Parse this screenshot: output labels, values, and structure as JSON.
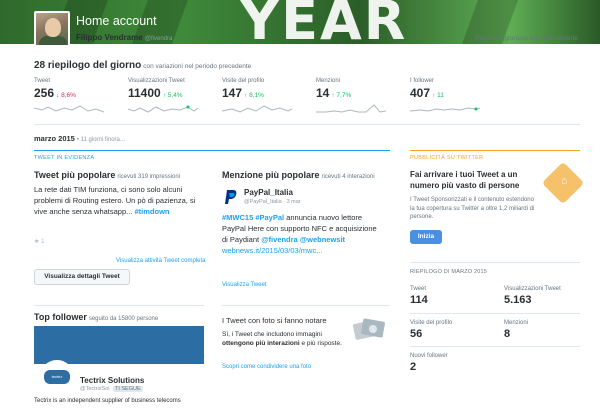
{
  "header": {
    "title": "Home account",
    "background_word": "YEAR"
  },
  "profile": {
    "name": "Filippo Vendrame",
    "handle": "@fivendra"
  },
  "updated_note": "Pagina aggiornata quotidianamente",
  "summary": {
    "title": "28 riepilogo del giorno",
    "subtitle": "con variazioni nel periodo precedente",
    "stats": [
      {
        "label": "Tweet",
        "value": "256",
        "change": "↓ 8,6%",
        "trend": "down"
      },
      {
        "label": "Visualizzazioni Tweet",
        "value": "11400",
        "change": "↑ 5,4%",
        "trend": "up"
      },
      {
        "label": "Visite del profilo",
        "value": "147",
        "change": "↑ 8,1%",
        "trend": "up"
      },
      {
        "label": "Menzioni",
        "value": "14",
        "change": "↑ 7,7%",
        "trend": "up"
      },
      {
        "label": "I follower",
        "value": "407",
        "change": "↑ 11",
        "trend": "up"
      }
    ]
  },
  "month": {
    "title": "marzo 2015",
    "subtitle": "• 11 giorni finora..."
  },
  "top_tweet": {
    "section_label": "Tweet in evidenza",
    "title": "Tweet più popolare",
    "meta": "ricevuti 319 impressioni",
    "text": "La rete dati TIM funziona, ci sono solo alcuni problemi di Routing estero. Un pò di pazienza, si vive anche senza whatsapp...",
    "hashtag": "#timdown",
    "retweet_count": "1",
    "activity_link": "Visualizza attività Tweet completa",
    "details_button": "Visualizza dettagli Tweet"
  },
  "top_mention": {
    "title": "Menzione più popolare",
    "meta": "ricevuti 4 interazioni",
    "author": "PayPal_Italia",
    "handle": "@PayPal_Italia · 3 mar",
    "text_tags": "#MWC15 #PayPal",
    "text_1": " annuncia nuovo lettore PayPal Here con supporto NFC e acquisizione di Paydiant ",
    "mention_1": "@fivendra",
    "mention_2": "@webnewsit",
    "url": "webnews.it/2015/03/03/mwc...",
    "view_link": "Visualizza Tweet"
  },
  "top_follower": {
    "title": "Top follower",
    "meta": "seguito da 15800 persone",
    "name": "Tectrix Solutions",
    "handle": "@TectrixSol",
    "follow_badge": "TI SEGUE",
    "bio": "Tectrix is an independent supplier of business telecoms",
    "logo_text": "tectrix solutions"
  },
  "photo_tip": {
    "title": "I Tweet con foto si fanno notare",
    "text_a": "Sì, i Tweet che includono immagini ",
    "text_bold": "ottengono più interazioni",
    "text_b": " e più risposte.",
    "link": "Scopri come condividere una foto"
  },
  "promo": {
    "section_label": "Pubblicità su Twitter",
    "title": "Fai arrivare i tuoi Tweet a un numero più vasto di persone",
    "text": "I Tweet Sponsorizzati e il contenuto estendono la tua copertura su Twitter a oltre 1,2 miliardi di persone.",
    "button": "Inizia"
  },
  "march_summary": {
    "section_label": "Riepilogo di marzo 2015",
    "items": [
      {
        "label": "Tweet",
        "value": "114"
      },
      {
        "label": "Visualizzazioni Tweet",
        "value": "5.163"
      },
      {
        "label": "Visite del profilo",
        "value": "56"
      },
      {
        "label": "Menzioni",
        "value": "8"
      },
      {
        "label": "Nuovi follower",
        "value": "2"
      }
    ]
  },
  "colors": {
    "accent": "#1da1f2",
    "promo": "#f5a623",
    "up": "#17bf63",
    "down": "#e0245e"
  }
}
